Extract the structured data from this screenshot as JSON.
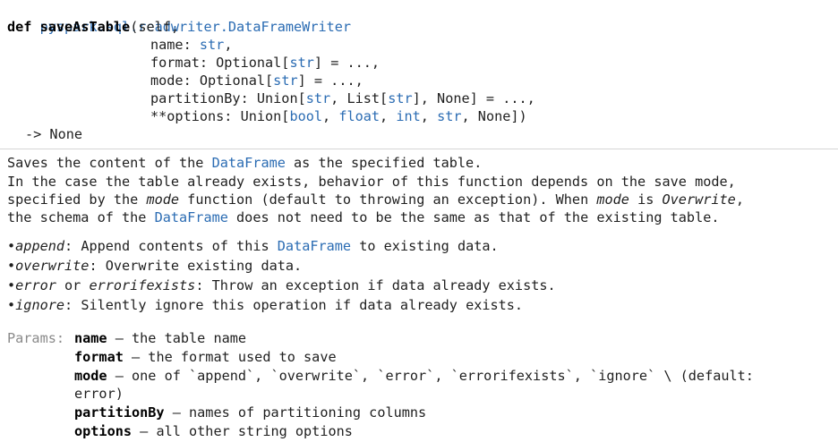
{
  "signature": {
    "module_path": "pyspark.sql.readwriter.DataFrameWriter",
    "def_keyword": "def",
    "function_name": "saveAsTable",
    "open": "(self,",
    "params": [
      {
        "name": "name",
        "sep": ": ",
        "type1": "str",
        "rest": ","
      },
      {
        "name": "format",
        "sep": ": Optional[",
        "type1": "str",
        "rest": "] = ...,"
      },
      {
        "name": "mode",
        "sep": ": Optional[",
        "type1": "str",
        "rest": "] = ...,"
      }
    ],
    "partition": {
      "prefix": "partitionBy: Union[",
      "t1": "str",
      "mid1": ", List[",
      "t2": "str",
      "tail": "], None] = ...,"
    },
    "options": {
      "prefix": "**options: Union[",
      "t1": "bool",
      "s1": ", ",
      "t2": "float",
      "s2": ", ",
      "t3": "int",
      "s3": ", ",
      "t4": "str",
      "tail": ", None])"
    },
    "return": "-> None"
  },
  "doc": {
    "summary_a": "Saves the content of the ",
    "dataframe_link": "DataFrame",
    "summary_b": " as the specified table.",
    "p1_l1": "In the case the table already exists, behavior of this function depends on the save mode,",
    "p1_l2a": "specified by the ",
    "p1_l2_mode": "mode",
    "p1_l2b": " function (default to throwing an exception). When ",
    "p1_l2_mode2": "mode",
    "p1_l2c": " is ",
    "p1_l2_over": "Overwrite",
    "p1_l2d": ",",
    "p1_l3a": "the schema of the ",
    "p1_l3_df": "DataFrame",
    "p1_l3b": " does not need to be the same as that of the existing table.",
    "bullets": [
      {
        "term": "append",
        "text_a": ": Append contents of this ",
        "link": "DataFrame",
        "text_b": " to existing data."
      },
      {
        "term": "overwrite",
        "text_a": ": Overwrite existing data.",
        "link": "",
        "text_b": ""
      },
      {
        "term": "error",
        "or": " or ",
        "term2": "errorifexists",
        "text_a": ": Throw an exception if data already exists.",
        "link": "",
        "text_b": ""
      },
      {
        "term": "ignore",
        "text_a": ": Silently ignore this operation if data already exists.",
        "link": "",
        "text_b": ""
      }
    ],
    "params_label": "Params:",
    "params": [
      {
        "name": "name",
        "desc": " – the table name"
      },
      {
        "name": "format",
        "desc": " – the format used to save"
      },
      {
        "name": "mode",
        "desc": " – one of `append`, `overwrite`, `error`, `errorifexists`, `ignore` \\ (default:"
      },
      {
        "name": "",
        "desc": "error)"
      },
      {
        "name": "partitionBy",
        "desc": " – names of partitioning columns"
      },
      {
        "name": "options",
        "desc": " – all other string options"
      }
    ],
    "bullet_char": "•"
  }
}
